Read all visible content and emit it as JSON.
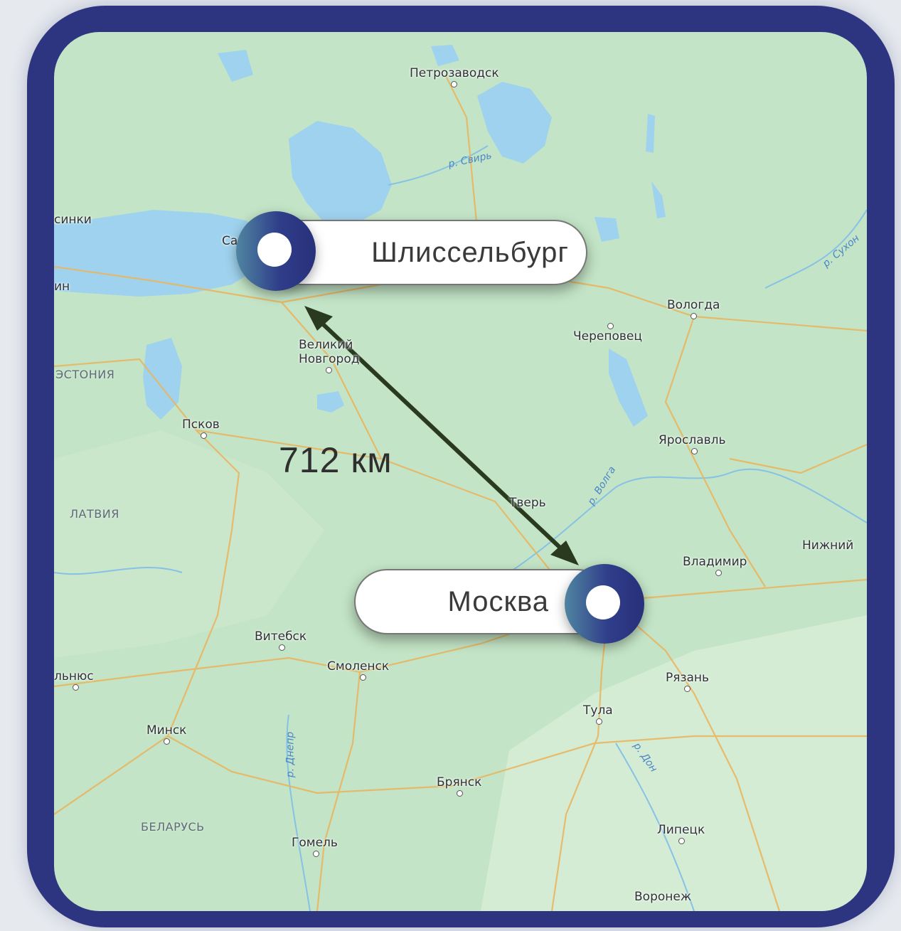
{
  "route": {
    "origin": "Шлиссельбург",
    "destination": "Москва",
    "distance_label": "712 км"
  },
  "cities": {
    "petrozavodsk": "Петрозаводск",
    "helsinki": "синки",
    "tallinn": "ин",
    "spb": "Са",
    "velikiy_novgorod_1": "Великий",
    "velikiy_novgorod_2": "Новгород",
    "vologda": "Вологда",
    "cherepovets": "Череповец",
    "pskov": "Псков",
    "yaroslavl": "Ярославль",
    "tver": "Тверь",
    "nizhniy": "Нижний",
    "vladimir": "Владимир",
    "vitebsk": "Витебск",
    "smolensk": "Смоленск",
    "vilnius": "льнюс",
    "ryazan": "Рязань",
    "tula": "Тула",
    "minsk": "Минск",
    "bryansk": "Брянск",
    "gomel": "Гомель",
    "lipetsk": "Липецк",
    "voronezh": "Воронеж"
  },
  "countries": {
    "estonia": "ЭСТОНИЯ",
    "latvia": "ЛАТВИЯ",
    "belarus": "БЕЛАРУСЬ"
  },
  "rivers": {
    "svir": "р. Свирь",
    "sukhona": "р. Сухон",
    "volga": "р. Волга",
    "don": "р. Дон",
    "dnepr": "р. Днепр"
  },
  "colors": {
    "frame": "#2d3580",
    "land": "#c3e4c6",
    "water": "#9fd2ee",
    "road": "#e8b661",
    "route_arrow": "#2a3a1f"
  }
}
